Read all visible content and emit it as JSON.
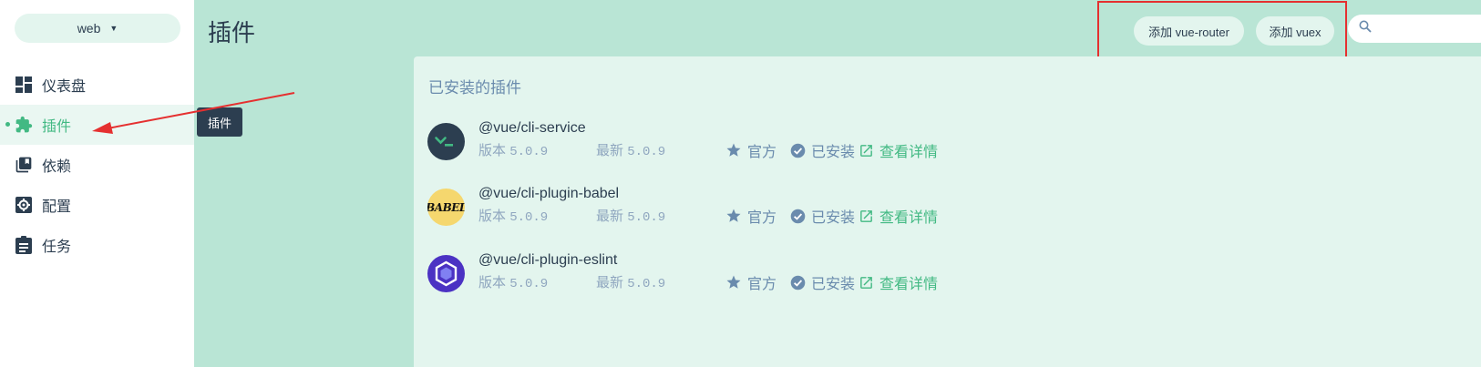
{
  "sidebar": {
    "project_name": "web",
    "items": [
      {
        "label": "仪表盘",
        "icon": "dashboard-icon"
      },
      {
        "label": "插件",
        "icon": "puzzle-icon"
      },
      {
        "label": "依赖",
        "icon": "library-icon"
      },
      {
        "label": "配置",
        "icon": "settings-icon"
      },
      {
        "label": "任务",
        "icon": "assignment-icon"
      }
    ],
    "active_index": 1
  },
  "tooltip": {
    "text": "插件"
  },
  "header": {
    "title": "插件",
    "add_router_label": "添加 vue-router",
    "add_vuex_label": "添加 vuex",
    "search_placeholder": ""
  },
  "panel": {
    "title": "已安装的插件",
    "plugins": [
      {
        "name": "@vue/cli-service",
        "version_label": "版本",
        "version": "5.0.9",
        "latest_label": "最新",
        "latest": "5.0.9",
        "official": "官方",
        "installed": "已安装",
        "details": "查看详情",
        "logo": "cli-service-logo"
      },
      {
        "name": "@vue/cli-plugin-babel",
        "version_label": "版本",
        "version": "5.0.9",
        "latest_label": "最新",
        "latest": "5.0.9",
        "official": "官方",
        "installed": "已安装",
        "details": "查看详情",
        "logo": "babel-logo"
      },
      {
        "name": "@vue/cli-plugin-eslint",
        "version_label": "版本",
        "version": "5.0.9",
        "latest_label": "最新",
        "latest": "5.0.9",
        "official": "官方",
        "installed": "已安装",
        "details": "查看详情",
        "logo": "eslint-logo"
      }
    ]
  },
  "colors": {
    "accent": "#42b983",
    "background": "#b9e5d5",
    "panel": "#e3f5ee",
    "annotation": "#e53030",
    "muted": "#6a8bad"
  }
}
